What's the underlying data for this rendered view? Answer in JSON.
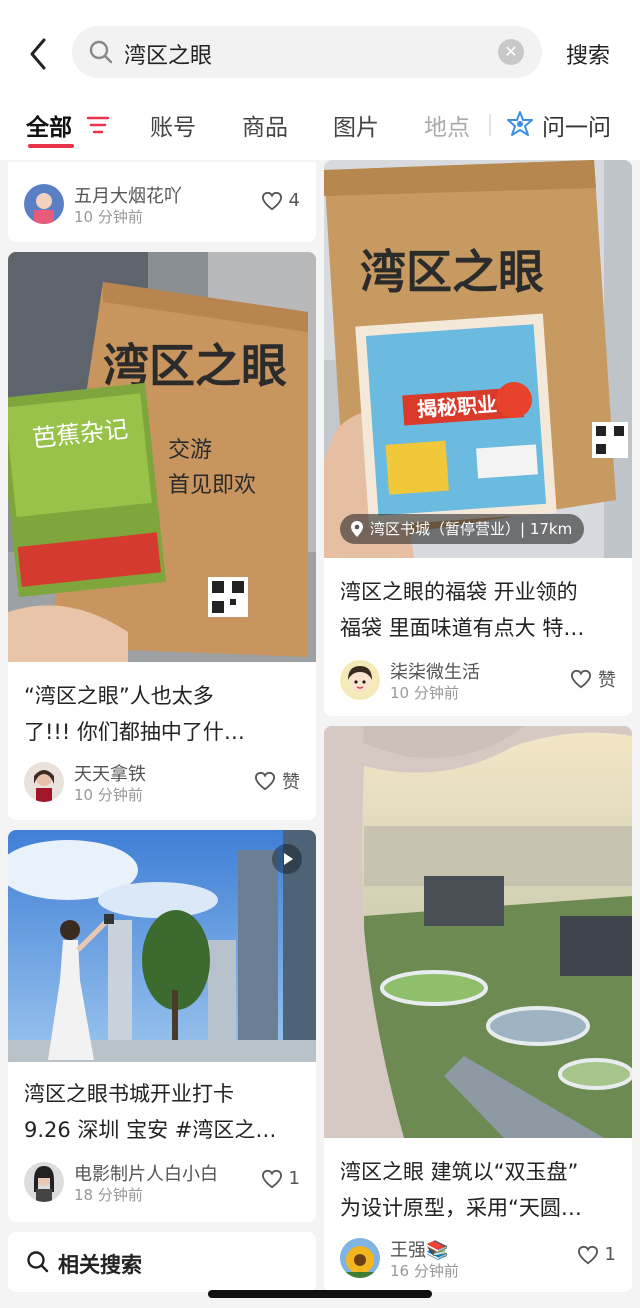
{
  "search": {
    "query": "湾区之眼",
    "submit_label": "搜索"
  },
  "tabs": [
    "全部",
    "账号",
    "商品",
    "图片",
    "地点"
  ],
  "ask": {
    "label": "问一问"
  },
  "colors": {
    "accent": "#e8334a"
  },
  "cards": {
    "c0": {
      "author": "五月大烟花吖",
      "time": "10 分钟前",
      "likes": "4"
    },
    "c1": {
      "cover_text": "湾区之眼",
      "book_title": "芭蕉杂记",
      "title_line1": "“湾区之眼”人也太多",
      "title_line2": "了!!! 你们都抽中了什…",
      "author": "天天拿铁",
      "time": "10 分钟前",
      "likes": "赞"
    },
    "c2": {
      "title_line1": "湾区之眼书城开业打卡",
      "title_line2": "9.26 深圳 宝安 #湾区之…",
      "author": "电影制片人白小白",
      "time": "18 分钟前",
      "likes": "1"
    },
    "c3": {
      "cover_text": "湾区之眼",
      "book_title": "揭秘职业",
      "location": "湾区书城（暂停营业）| 17km",
      "title_line1": "湾区之眼的福袋 开业领的",
      "title_line2": "福袋 里面味道有点大 特…",
      "author": "柒柒微生活",
      "time": "10 分钟前",
      "likes": "赞"
    },
    "c4": {
      "title_line1": "湾区之眼 建筑以“双玉盘”",
      "title_line2": "为设计原型，采用“天圆…",
      "author": "王强📚",
      "time": "16 分钟前",
      "likes": "1"
    }
  },
  "related": {
    "label": "相关搜索"
  },
  "icons": [
    "back-arrow-icon",
    "search-icon",
    "clear-icon",
    "filter-icon",
    "ask-icon",
    "heart-icon",
    "location-pin-icon",
    "video-icon"
  ]
}
